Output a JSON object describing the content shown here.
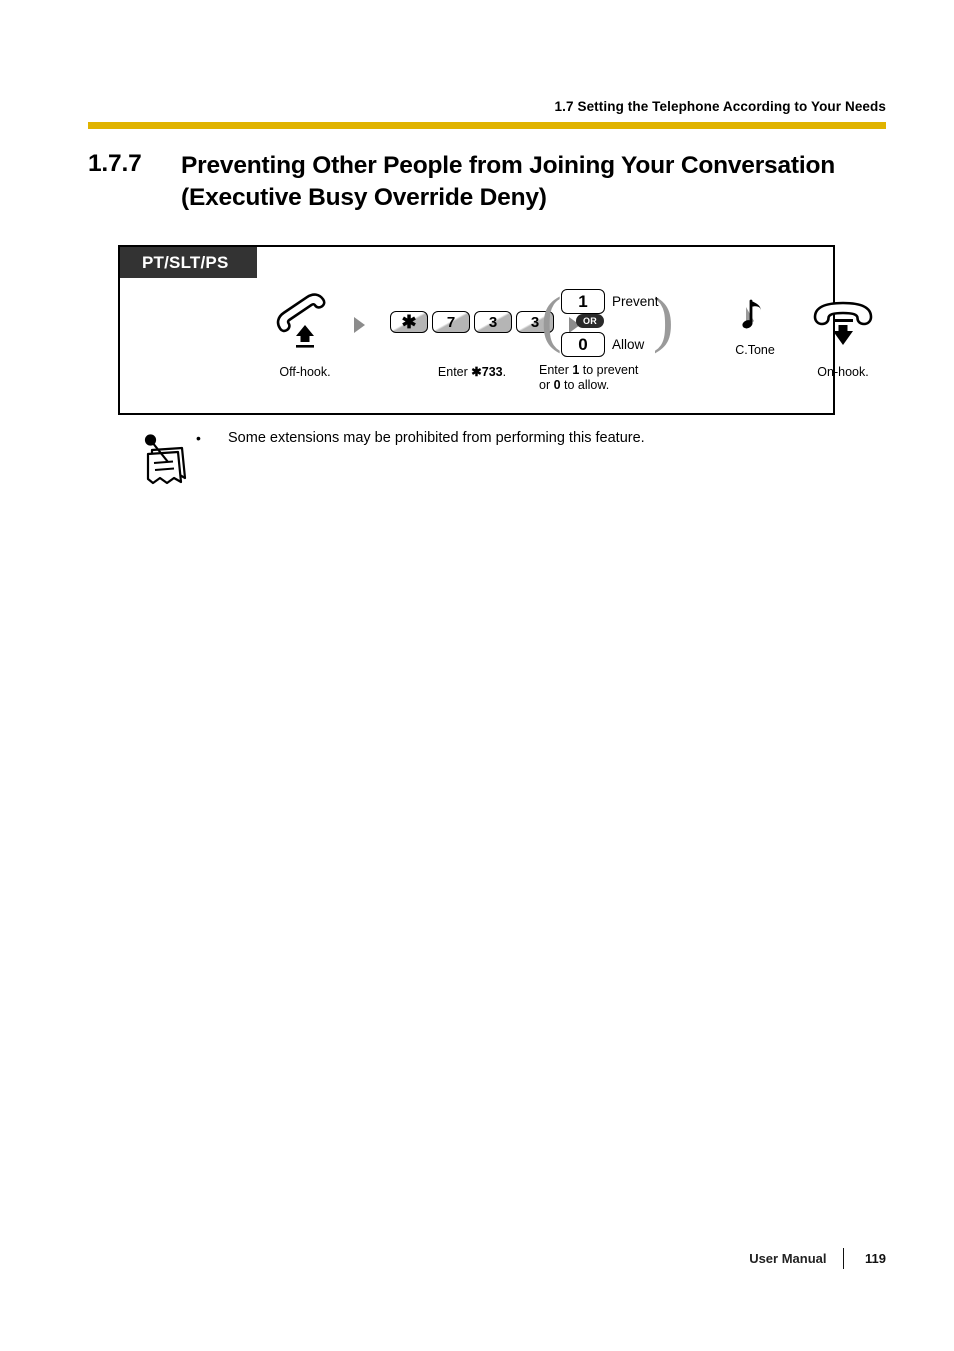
{
  "header": {
    "running_head": "1.7 Setting the Telephone According to Your Needs",
    "rule_color": "#e0b300"
  },
  "section": {
    "number": "1.7.7",
    "title": "Preventing Other People from Joining Your Conversation (Executive Busy Override Deny)"
  },
  "procedure": {
    "tab_label": "PT/SLT/PS",
    "steps": [
      {
        "id": "off-hook",
        "icon": "handset-off-hook-icon",
        "caption": "Off-hook."
      },
      {
        "id": "enter-code",
        "keys": [
          "✱",
          "7",
          "3",
          "3"
        ],
        "caption_prefix": "Enter ",
        "caption_code": "✱733",
        "caption_suffix": "."
      },
      {
        "id": "choose-option",
        "options": [
          {
            "key": "1",
            "label": "Prevent"
          },
          {
            "key": "0",
            "label": "Allow"
          }
        ],
        "or_label": "OR",
        "caption_line1_a": "Enter ",
        "caption_line1_b": "1",
        "caption_line1_c": " to prevent",
        "caption_line2_a": "or ",
        "caption_line2_b": "0",
        "caption_line2_c": " to allow."
      },
      {
        "id": "confirmation-tone",
        "icon": "music-note-icon",
        "label": "C.Tone"
      },
      {
        "id": "on-hook",
        "icon": "handset-on-hook-icon",
        "caption": "On-hook."
      }
    ]
  },
  "note": {
    "icon": "notepad-pencil-icon",
    "bullet": "•",
    "text": "Some extensions may be prohibited from performing this feature."
  },
  "footer": {
    "label": "User Manual",
    "page": "119"
  }
}
